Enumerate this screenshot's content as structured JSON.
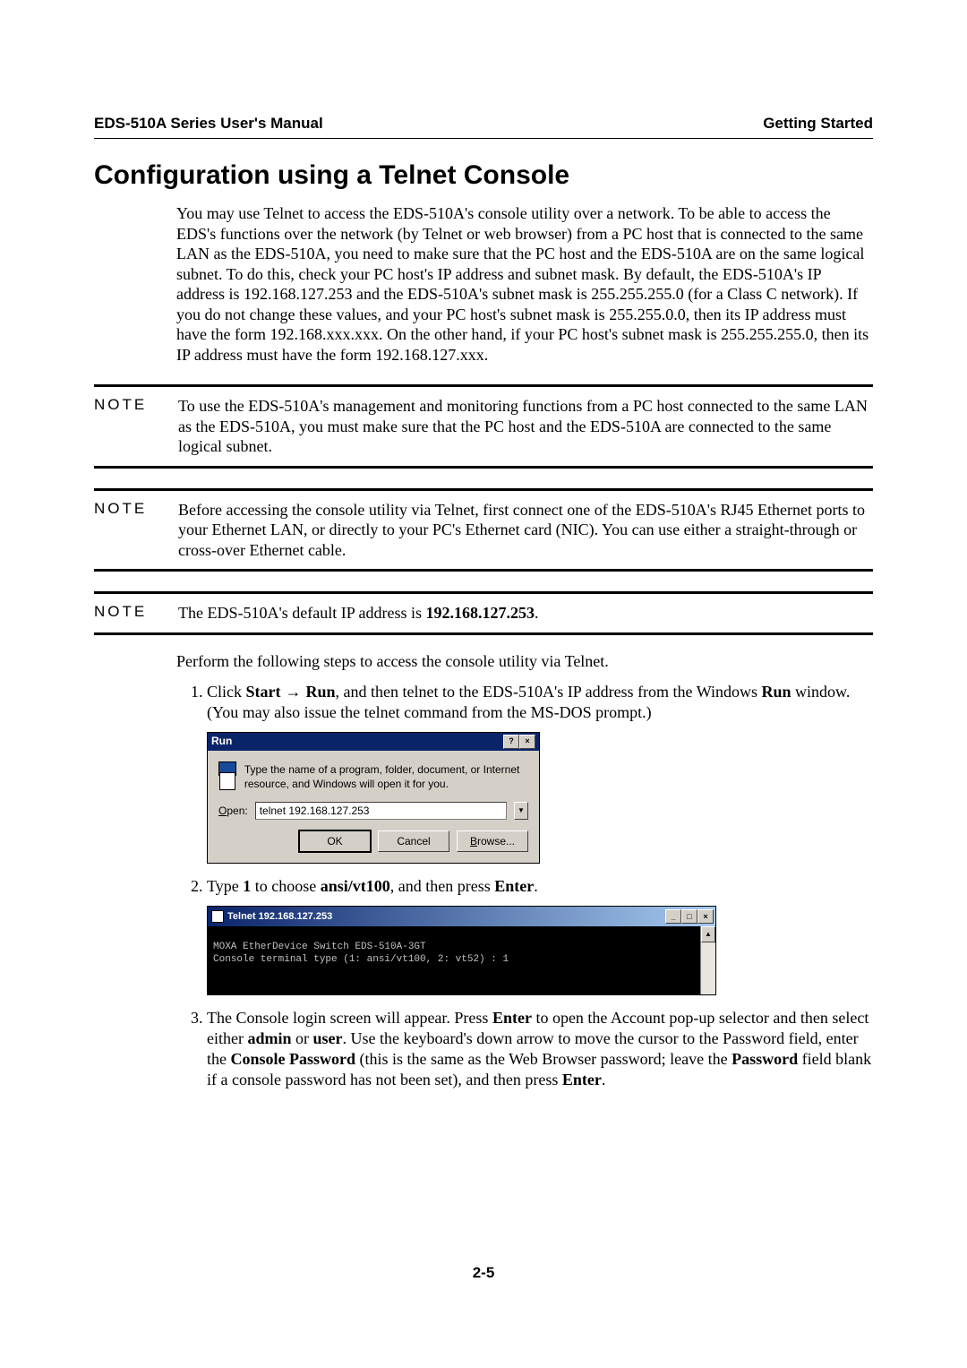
{
  "header": {
    "left": "EDS-510A Series User's Manual",
    "right": "Getting Started"
  },
  "section_title": "Configuration using a Telnet Console",
  "intro_paragraph": "You may use Telnet to access the EDS-510A's console utility over a network. To be able to access the EDS's functions over the network (by Telnet or web browser) from a PC host that is connected to the same LAN as the EDS-510A, you need to make sure that the PC host and the EDS-510A are on the same logical subnet. To do this, check your PC host's IP address and subnet mask. By default, the EDS-510A's IP address is 192.168.127.253 and the EDS-510A's subnet mask is 255.255.255.0 (for a Class C network). If you do not change these values, and your PC host's subnet mask is 255.255.0.0, then its IP address must have the form 192.168.xxx.xxx. On the other hand, if your PC host's subnet mask is 255.255.255.0, then its IP address must have the form 192.168.127.xxx.",
  "notes": [
    {
      "label": "NOTE",
      "text": "To use the EDS-510A's management and monitoring functions from a PC host connected to the same LAN as the EDS-510A, you must make sure that the PC host and the EDS-510A are connected to the same logical subnet."
    },
    {
      "label": "NOTE",
      "text": "Before accessing the console utility via Telnet, first connect one of the EDS-510A's RJ45 Ethernet ports to your Ethernet LAN, or directly to your PC's Ethernet card (NIC). You can use either a straight-through or cross-over Ethernet cable."
    },
    {
      "label": "NOTE",
      "text_prefix": "The EDS-510A's default IP address is ",
      "text_bold": "192.168.127.253",
      "text_suffix": "."
    }
  ],
  "perform_steps_intro": "Perform the following steps to access the console utility via Telnet.",
  "steps": {
    "s1": {
      "t1": "Click ",
      "b1": "Start",
      "arrow": " → ",
      "b2": "Run",
      "t2": ", and then telnet to the EDS-510A's IP address from the Windows ",
      "b3": "Run",
      "t3": " window. (You may also issue the telnet command from the MS-DOS prompt.)"
    },
    "s2": {
      "t1": "Type ",
      "b1": "1",
      "t2": " to choose ",
      "b2": "ansi/vt100",
      "t3": ", and then press ",
      "b3": "Enter",
      "t4": "."
    },
    "s3": {
      "t1": "The Console login screen will appear. Press ",
      "b1": "Enter",
      "t2": " to open the Account pop-up selector and then select either ",
      "b2": "admin",
      "t3": " or ",
      "b3": "user",
      "t4": ". Use the keyboard's down arrow to move the cursor to the Password field, enter the ",
      "b4": "Console Password",
      "t5": " (this is the same as the Web Browser password; leave the ",
      "b5": "Password",
      "t6": " field blank if a console password has not been set), and then press ",
      "b6": "Enter",
      "t7": "."
    }
  },
  "run_dialog": {
    "title": "Run",
    "help_icon": "?",
    "close_icon": "×",
    "description": "Type the name of a program, folder, document, or Internet resource, and Windows will open it for you.",
    "open_label_u": "O",
    "open_label_rest": "pen:",
    "input_value": "telnet 192.168.127.253",
    "dropdown_icon": "▼",
    "btn_ok": "OK",
    "btn_cancel": "Cancel",
    "btn_browse_u": "B",
    "btn_browse_rest": "rowse..."
  },
  "telnet_window": {
    "title": "Telnet 192.168.127.253",
    "min_icon": "_",
    "max_icon": "□",
    "close_icon": "×",
    "scroll_up": "▲",
    "body_line1": "MOXA EtherDevice Switch EDS-510A-3GT",
    "body_line2": "Console terminal type (1: ansi/vt100, 2: vt52) : 1"
  },
  "page_number": "2-5"
}
